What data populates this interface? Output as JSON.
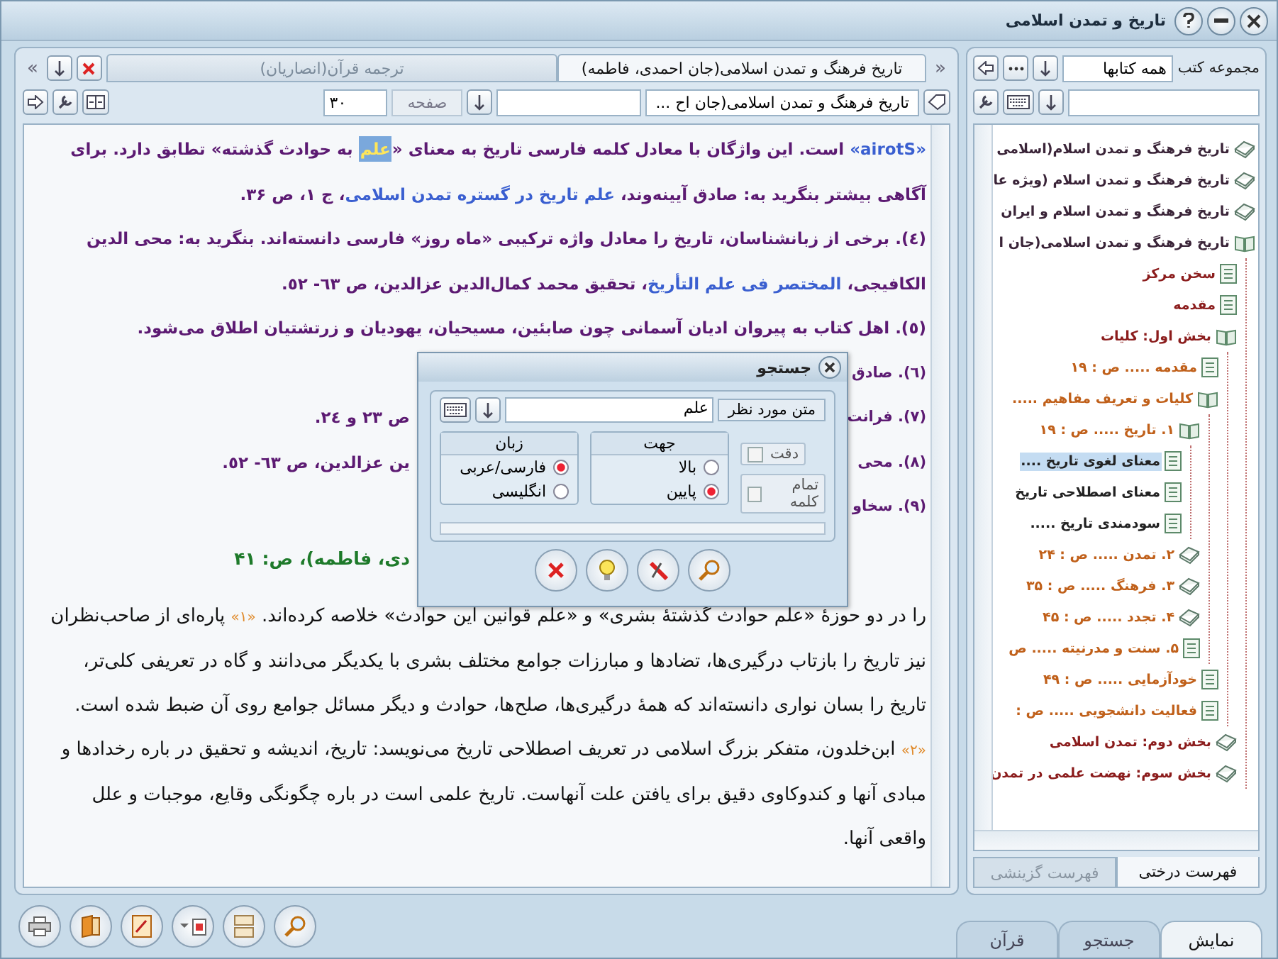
{
  "window": {
    "title": "تاریخ و تمدن اسلامی"
  },
  "reader": {
    "scroll_left": "«",
    "scroll_right": "»",
    "tabs": [
      {
        "label": "تاریخ فرهنگ و تمدن اسلامی(جان احمدی، فاطمه)",
        "selected": true
      },
      {
        "label": "ترجمه قرآن(انصاریان)",
        "selected": false
      }
    ],
    "book_select": "تاریخ فرهنگ و تمدن اسلامی(جان اح ...",
    "page_label": "صفحه",
    "page_value": "۳۰",
    "paragraphs": [
      {
        "kind": "note",
        "segments": [
          {
            "kind": "link",
            "text": "«airotS»"
          },
          {
            "kind": "text",
            "text": " است. این واژگان با معادل کلمه فارسی تاریخ به معنای «"
          },
          {
            "kind": "hit",
            "text": "علم"
          },
          {
            "kind": "text",
            "text": " به حوادث گذشته» تطابق دارد. برای آگاهی بیشتر بنگرید به: صادق آیینه‌وند، "
          },
          {
            "kind": "link",
            "text": "علم تاریخ در گستره تمدن اسلامی"
          },
          {
            "kind": "text",
            "text": "، ج ۱، ص ۳۶."
          }
        ]
      },
      {
        "kind": "note",
        "segments": [
          {
            "kind": "text",
            "text": "(٤). برخی از زبانشناسان، تاریخ را معادل واژه ترکیبی «ماه روز» فارسی دانسته‌اند. بنگرید به: محی الدین الکافیجی، "
          },
          {
            "kind": "link",
            "text": "المختصر فی علم التأریخ"
          },
          {
            "kind": "text",
            "text": "، تحقیق محمد کمال‌الدین عزالدین، ص ٦٣- ٥٢."
          }
        ]
      },
      {
        "kind": "note",
        "segments": [
          {
            "kind": "text",
            "text": "(٥). اهل کتاب به پیروان ادیان آسمانی چون صابئین، مسیحیان، یهودیان و زرتشتیان اطلاق می‌شود."
          }
        ]
      },
      {
        "kind": "covered",
        "right": "(٦). صادق"
      },
      {
        "kind": "covered",
        "right": "(٧). فرانت",
        "left": "ص ٢٣ و ٢٤."
      },
      {
        "kind": "covered",
        "right": "(٨). محی",
        "left": "ین عزالدین، ص ٦٣- ٥٢."
      },
      {
        "kind": "covered",
        "right": "(٩). سخاو"
      },
      {
        "kind": "heading",
        "left": "دی، فاطمه)، ص: ۴۱"
      },
      {
        "kind": "body",
        "segments": [
          {
            "kind": "text",
            "text": "را در دو حوزهٔ «علم حوادث گذشتهٔ بشری» و «علم قوانین این حوادث» خلاصه کرده‌اند. "
          },
          {
            "kind": "mark",
            "text": "«۱»"
          },
          {
            "kind": "text",
            "text": " پاره‌ای از صاحب‌نظران نیز تاریخ را بازتاب درگیری‌ها، تضادها و مبارزات جوامع مختلف بشری با یکدیگر می‌دانند و گاه در تعریفی کلی‌تر، تاریخ را بسان نواری دانسته‌اند که همهٔ درگیری‌ها، صلح‌ها، حوادث و دیگر مسائل جوامع روی آن ضبط شده است. "
          },
          {
            "kind": "mark",
            "text": "«۲»"
          },
          {
            "kind": "text",
            "text": " ابن‌خلدون، متفکر بزرگ اسلامی در تعریف اصطلاحی تاریخ می‌نویسد: تاریخ، اندیشه و تحقیق در باره رخدادها و مبادی آنها و کندوکاوی دقیق برای یافتن علت آنهاست. تاریخ علمی است در باره چگونگی وقایع، موجبات و علل واقعی آنها."
          }
        ]
      }
    ]
  },
  "library": {
    "label": "مجموعه کتب",
    "collection": "همه کتابها",
    "tree": [
      {
        "label": "تاریخ فرهنگ و تمدن اسلام(اسلامی",
        "kind": "book",
        "selected": false
      },
      {
        "label": "تاریخ فرهنگ و تمدن اسلام (ویژه عا",
        "kind": "book",
        "selected": false
      },
      {
        "label": "تاریخ فرهنگ و تمدن اسلام و ایران",
        "kind": "book",
        "selected": false
      },
      {
        "label": "تاریخ فرهنگ و تمدن اسلامی(جان ا",
        "kind": "open",
        "selected": false,
        "children": [
          {
            "label": "سخن مرکز",
            "kind": "page",
            "selected": false
          },
          {
            "label": "مقدمه",
            "kind": "page",
            "selected": false
          },
          {
            "label": "بخش اول: کلیات",
            "kind": "open",
            "selected": false,
            "children": [
              {
                "label": "مقدمه ..... ص : ۱۹",
                "kind": "page",
                "selected": false
              },
              {
                "label": "کلیات و تعریف مفاهیم .....",
                "kind": "open",
                "selected": false,
                "children": [
                  {
                    "label": "۱. تاریخ ..... ص : ۱۹",
                    "kind": "open",
                    "selected": false,
                    "children": [
                      {
                        "label": "معنای لغوی تاریخ ....",
                        "kind": "page",
                        "selected": true
                      },
                      {
                        "label": "معنای اصطلاحی تاریخ",
                        "kind": "page",
                        "selected": false
                      },
                      {
                        "label": "سودمندی تاریخ .....",
                        "kind": "page",
                        "selected": false
                      }
                    ]
                  },
                  {
                    "label": "۲. تمدن ..... ص : ۲۴",
                    "kind": "book",
                    "selected": false
                  },
                  {
                    "label": "۳. فرهنگ ..... ص : ۳۵",
                    "kind": "book",
                    "selected": false
                  },
                  {
                    "label": "۴. تجدد ..... ص : ۴۵",
                    "kind": "book",
                    "selected": false
                  },
                  {
                    "label": "۵. سنت و مدرنیته ..... ص",
                    "kind": "page",
                    "selected": false
                  }
                ]
              },
              {
                "label": "خودآزمایی ..... ص : ۴۹",
                "kind": "page",
                "selected": false
              },
              {
                "label": "فعالیت دانشجویی ..... ص :",
                "kind": "page",
                "selected": false
              }
            ]
          },
          {
            "label": "بخش دوم: تمدن اسلامی",
            "kind": "book",
            "selected": false
          },
          {
            "label": "بخش سوم: نهضت علمی در تمدن",
            "kind": "book",
            "selected": false
          }
        ]
      }
    ],
    "tabs": [
      {
        "label": "فهرست درختی",
        "selected": true
      },
      {
        "label": "فهرست گزینشی",
        "selected": false
      }
    ]
  },
  "bottom_tabs": [
    {
      "label": "نمایش",
      "selected": true
    },
    {
      "label": "جستجو",
      "selected": false
    },
    {
      "label": "قرآن",
      "selected": false
    }
  ],
  "search_dialog": {
    "title": "جستجو",
    "field_label": "متن مورد نظر",
    "value": "علم",
    "options": [
      {
        "label": "دقت",
        "checked": false
      },
      {
        "label": "تمام کلمه",
        "checked": false
      }
    ],
    "groups": [
      {
        "title": "جهت",
        "choices": [
          {
            "label": "بالا",
            "selected": false
          },
          {
            "label": "پایین",
            "selected": true
          }
        ]
      },
      {
        "title": "زبان",
        "choices": [
          {
            "label": "فارسی/عربی",
            "selected": true
          },
          {
            "label": "انگلیسی",
            "selected": false
          }
        ]
      }
    ],
    "progress": {
      "level": 0
    }
  }
}
